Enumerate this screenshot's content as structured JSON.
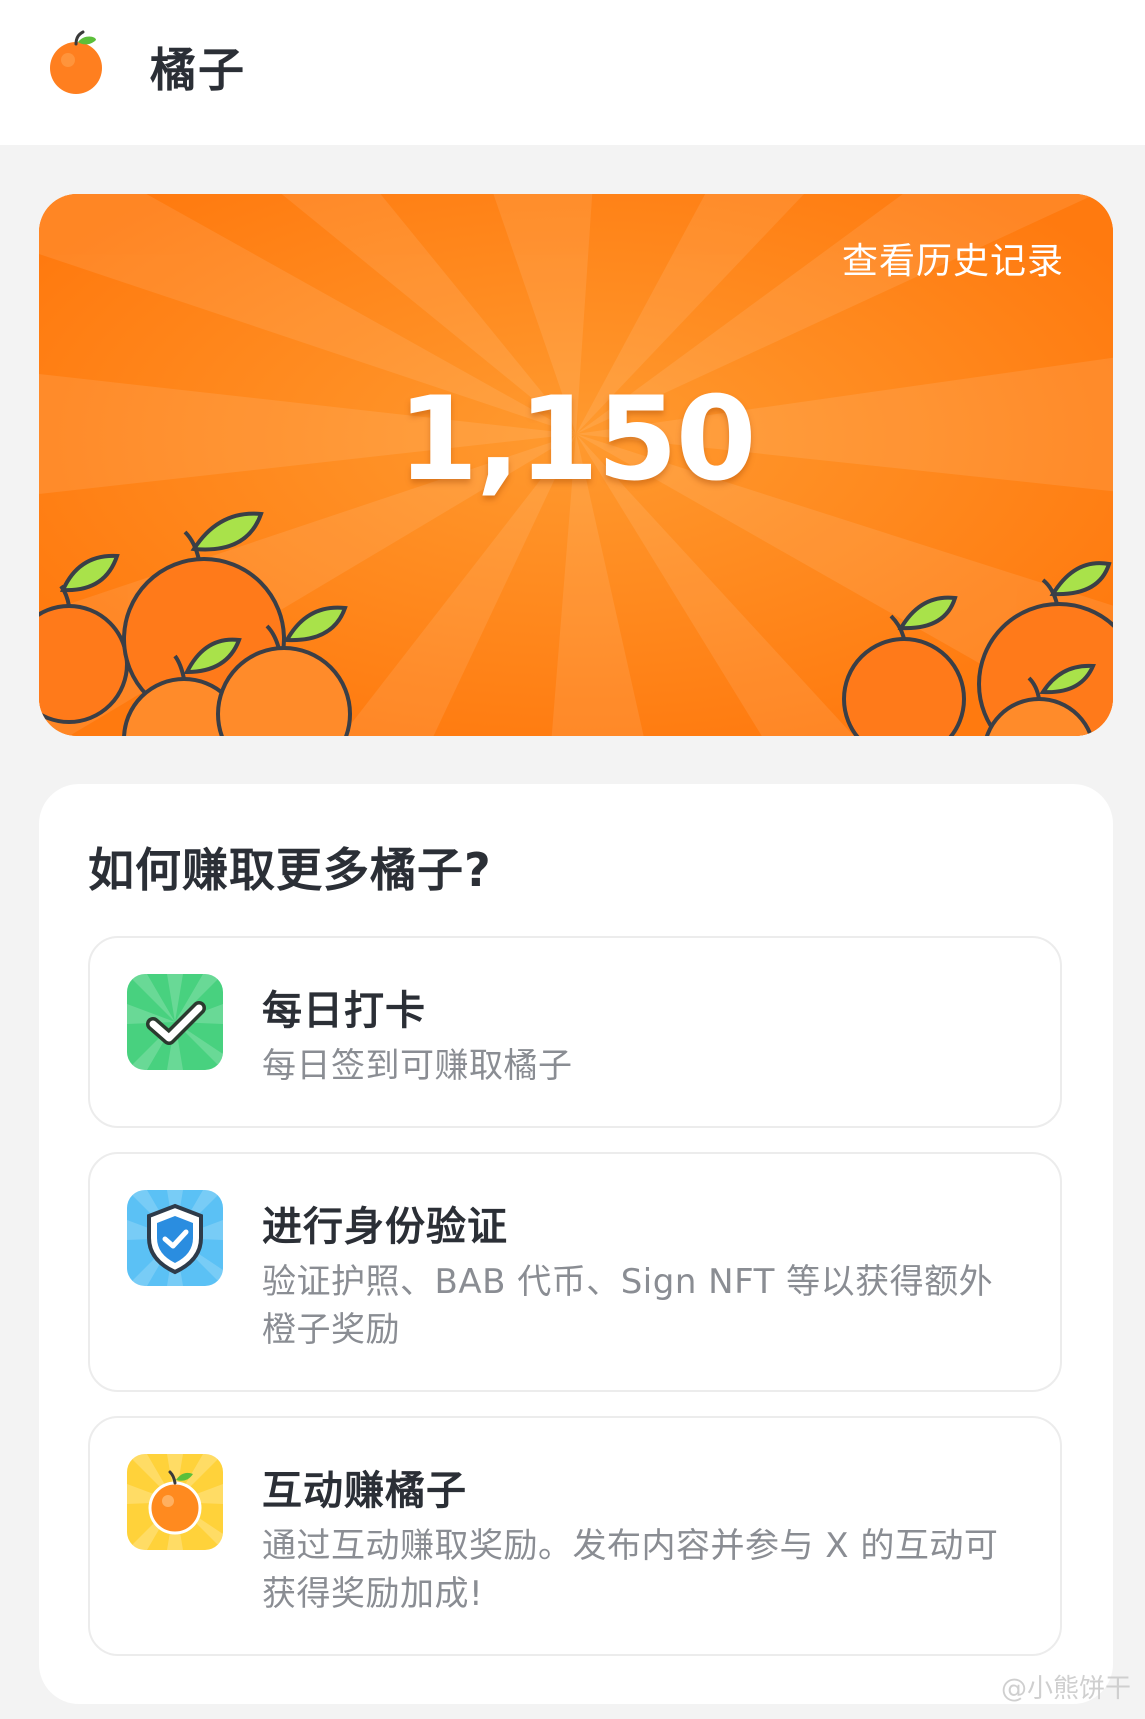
{
  "header": {
    "title": "橘子",
    "logo_icon": "orange-icon"
  },
  "balance": {
    "history_label": "查看历史记录",
    "value": "1,150",
    "accent": "#ff7a0f"
  },
  "earn": {
    "title": "如何赚取更多橘子?",
    "tasks": [
      {
        "icon": "check-icon",
        "title": "每日打卡",
        "desc": "每日签到可赚取橘子",
        "color": "#48d17f"
      },
      {
        "icon": "shield-check-icon",
        "title": "进行身份验证",
        "desc": "验证护照、BAB 代币、Sign NFT 等以获得额外橙子奖励",
        "color": "#5bc1f5"
      },
      {
        "icon": "orange-icon",
        "title": "互动赚橘子",
        "desc": "通过互动赚取奖励。发布内容并参与 X 的互动可获得奖励加成!",
        "color": "#ffd23a"
      }
    ]
  },
  "watermark": "@小熊饼干"
}
